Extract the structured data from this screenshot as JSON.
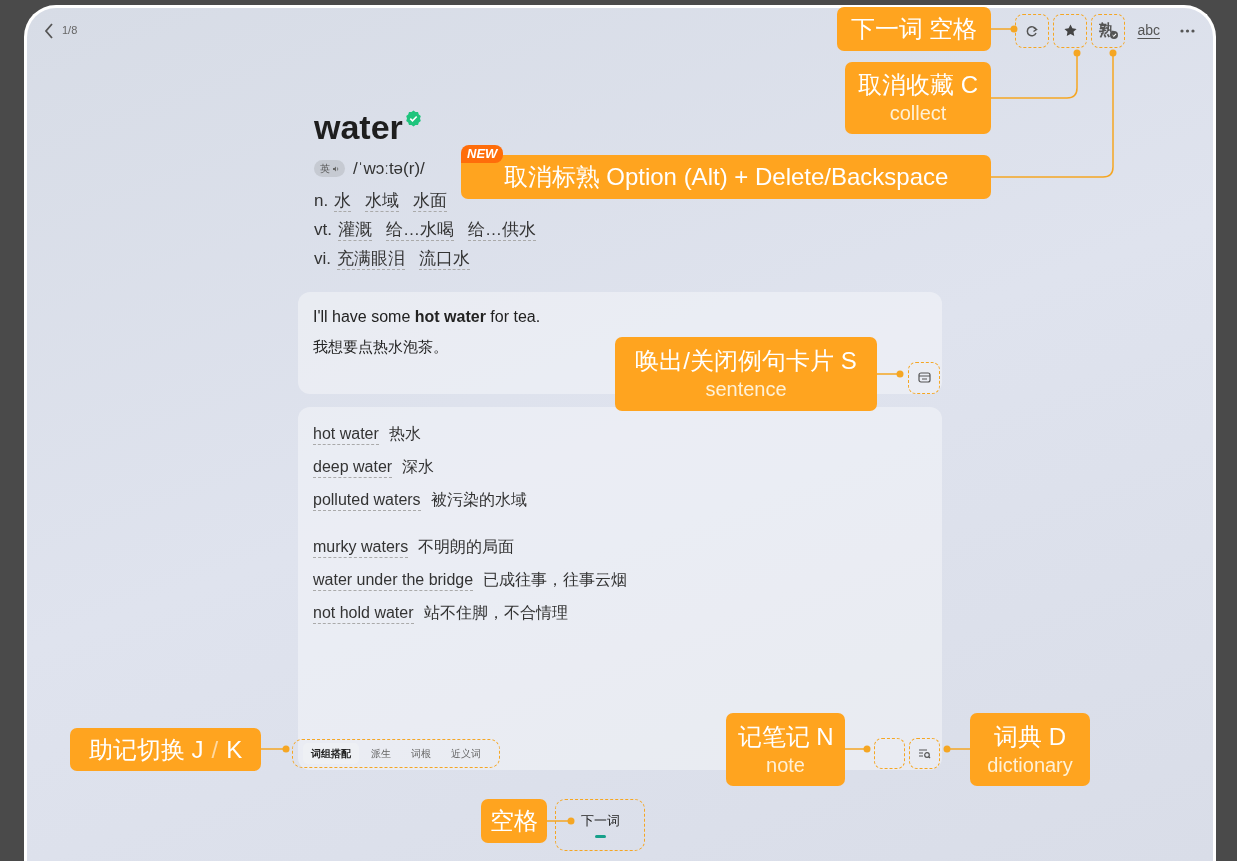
{
  "top_bar": {
    "counter": "1/8"
  },
  "toolbar": {
    "mastered_glyph": "熟",
    "spelling_label": "abc"
  },
  "word": {
    "headword": "water",
    "verified": true,
    "accent": "英",
    "phonetic": "/ˈwɔːtə(r)/"
  },
  "meanings": [
    {
      "pos": "n.",
      "senses": [
        "水",
        "水域",
        "水面"
      ]
    },
    {
      "pos": "vt.",
      "senses": [
        "灌溉",
        "给…水喝",
        "给…供水"
      ]
    },
    {
      "pos": "vi.",
      "senses": [
        "充满眼泪",
        "流口水"
      ]
    }
  ],
  "example": {
    "en": "I'll have some **hot water** for tea.",
    "zh": "我想要点热水泡茶。"
  },
  "phrase_groups": [
    [
      {
        "phrase": "hot water",
        "meaning": "热水"
      },
      {
        "phrase": "deep water",
        "meaning": "深水"
      },
      {
        "phrase": "polluted waters",
        "meaning": "被污染的水域"
      }
    ],
    [
      {
        "phrase": "murky waters",
        "meaning": "不明朗的局面"
      },
      {
        "phrase": "water under the bridge",
        "meaning": "已成往事，往事云烟"
      },
      {
        "phrase": "not hold water",
        "meaning": "站不住脚，不合情理"
      }
    ]
  ],
  "memory_tabs": [
    {
      "label": "词组搭配",
      "selected": true
    },
    {
      "label": "派生",
      "selected": false
    },
    {
      "label": "词根",
      "selected": false
    },
    {
      "label": "近义词",
      "selected": false
    }
  ],
  "next_button": {
    "label": "下一词"
  },
  "callouts": [
    {
      "title": "下一词 空格"
    },
    {
      "title": "取消收藏 C",
      "subtitle": "collect"
    },
    {
      "title": "取消标熟 Option (Alt) + Delete/Backspace",
      "badge": "NEW"
    },
    {
      "title": "唤出/关闭例句卡片 S",
      "subtitle": "sentence"
    },
    {
      "title": "助记切换 J",
      "separator": "/",
      "tail": "K"
    },
    {
      "title": "记笔记 N",
      "subtitle": "note"
    },
    {
      "title": "词典 D",
      "subtitle": "dictionary"
    },
    {
      "title": "空格"
    }
  ]
}
